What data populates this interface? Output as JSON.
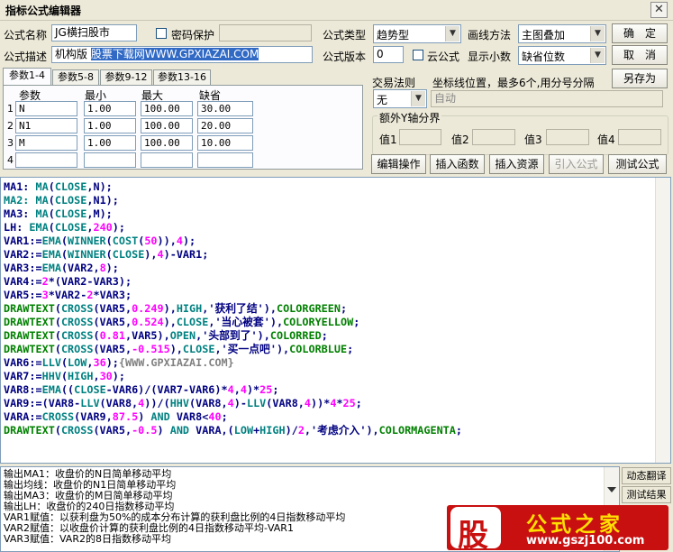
{
  "window": {
    "title": "指标公式编辑器",
    "close_glyph": "✕"
  },
  "form": {
    "name_label": "公式名称",
    "name_value": "JG横扫股市",
    "password_label": "密码保护",
    "desc_label": "公式描述",
    "desc_prefix": "机构版 ",
    "desc_highlight": "股票下载网WWW.GPXIAZAI.COM",
    "type_label": "公式类型",
    "type_value": "趋势型",
    "draw_label": "画线方法",
    "draw_value": "主图叠加",
    "version_label": "公式版本",
    "version_value": "0",
    "cloud_label": "云公式",
    "decimals_label": "显示小数",
    "decimals_value": "缺省位数"
  },
  "buttons": {
    "ok": "确　定",
    "cancel": "取　消",
    "save_as": "另存为",
    "edit_ops": "编辑操作",
    "insert_func": "插入函数",
    "insert_res": "插入资源",
    "import_formula": "引入公式",
    "test_formula": "测试公式"
  },
  "tabs": [
    "参数1-4",
    "参数5-8",
    "参数9-12",
    "参数13-16"
  ],
  "params": {
    "headers": [
      "参数",
      "最小",
      "最大",
      "缺省"
    ],
    "rows": [
      {
        "idx": "1",
        "name": "N",
        "min": "1.00",
        "max": "100.00",
        "def": "30.00"
      },
      {
        "idx": "2",
        "name": "N1",
        "min": "1.00",
        "max": "100.00",
        "def": "20.00"
      },
      {
        "idx": "3",
        "name": "M",
        "min": "1.00",
        "max": "100.00",
        "def": "10.00"
      },
      {
        "idx": "4",
        "name": "",
        "min": "",
        "max": "",
        "def": ""
      }
    ]
  },
  "trade": {
    "rule_label": "交易法则",
    "rule_value": "无",
    "coord_label": "坐标线位置，最多6个,用分号分隔",
    "coord_placeholder": "自动",
    "yaxis_label": "额外Y轴分界",
    "values": [
      "值1",
      "值2",
      "值3",
      "值4"
    ]
  },
  "code_lines": [
    [
      [
        "MA1: ",
        "#000080"
      ],
      [
        "MA",
        "#008080"
      ],
      [
        "(",
        "#000080"
      ],
      [
        "CLOSE",
        "#008080"
      ],
      [
        ",N);",
        "#000080"
      ]
    ],
    [
      [
        "MA2: ",
        "#008080"
      ],
      [
        "MA",
        "#008080"
      ],
      [
        "(",
        "#000080"
      ],
      [
        "CLOSE",
        "#008080"
      ],
      [
        ",N1);",
        "#000080"
      ]
    ],
    [
      [
        "MA3: ",
        "#000080"
      ],
      [
        "MA",
        "#008080"
      ],
      [
        "(",
        "#000080"
      ],
      [
        "CLOSE",
        "#008080"
      ],
      [
        ",M);",
        "#000080"
      ]
    ],
    [
      [
        "LH: ",
        "#000080"
      ],
      [
        "EMA",
        "#008080"
      ],
      [
        "(",
        "#000080"
      ],
      [
        "CLOSE",
        "#008080"
      ],
      [
        ",",
        "#000080"
      ],
      [
        "240",
        "#ff00ff"
      ],
      [
        ");",
        "#000080"
      ]
    ],
    [
      [
        "VAR1:=",
        "#000080"
      ],
      [
        "EMA",
        "#008080"
      ],
      [
        "(",
        "#000080"
      ],
      [
        "WINNER",
        "#008080"
      ],
      [
        "(",
        "#000080"
      ],
      [
        "COST",
        "#008080"
      ],
      [
        "(",
        "#000080"
      ],
      [
        "50",
        "#ff00ff"
      ],
      [
        ")),",
        "#000080"
      ],
      [
        "4",
        "#ff00ff"
      ],
      [
        ");",
        "#000080"
      ]
    ],
    [
      [
        "VAR2:=",
        "#000080"
      ],
      [
        "EMA",
        "#008080"
      ],
      [
        "(",
        "#000080"
      ],
      [
        "WINNER",
        "#008080"
      ],
      [
        "(",
        "#000080"
      ],
      [
        "CLOSE",
        "#008080"
      ],
      [
        "),",
        "#000080"
      ],
      [
        "4",
        "#ff00ff"
      ],
      [
        ")-VAR1;",
        "#000080"
      ]
    ],
    [
      [
        "VAR3:=",
        "#000080"
      ],
      [
        "EMA",
        "#008080"
      ],
      [
        "(VAR2,",
        "#000080"
      ],
      [
        "8",
        "#ff00ff"
      ],
      [
        ");",
        "#000080"
      ]
    ],
    [
      [
        "VAR4:=",
        "#000080"
      ],
      [
        "2",
        "#ff00ff"
      ],
      [
        "*(VAR2-VAR3);",
        "#000080"
      ]
    ],
    [
      [
        "VAR5:=",
        "#000080"
      ],
      [
        "3",
        "#ff00ff"
      ],
      [
        "*VAR2-",
        "#000080"
      ],
      [
        "2",
        "#ff00ff"
      ],
      [
        "*VAR3;",
        "#000080"
      ]
    ],
    [
      [
        "DRAWTEXT",
        "#008000"
      ],
      [
        "(",
        "#000080"
      ],
      [
        "CROSS",
        "#008080"
      ],
      [
        "(VAR5,",
        "#000080"
      ],
      [
        "0.249",
        "#ff00ff"
      ],
      [
        "),",
        "#000080"
      ],
      [
        "HIGH",
        "#008080"
      ],
      [
        ",",
        "#000080"
      ],
      [
        "'获利了结'",
        "#000080"
      ],
      [
        "),",
        "#000080"
      ],
      [
        "COLORGREEN",
        "#008000"
      ],
      [
        ";",
        "#000080"
      ]
    ],
    [
      [
        "DRAWTEXT",
        "#008000"
      ],
      [
        "(",
        "#000080"
      ],
      [
        "CROSS",
        "#008080"
      ],
      [
        "(VAR5,",
        "#000080"
      ],
      [
        "0.524",
        "#ff00ff"
      ],
      [
        "),",
        "#000080"
      ],
      [
        "CLOSE",
        "#008080"
      ],
      [
        ",",
        "#000080"
      ],
      [
        "'当心被套'",
        "#000080"
      ],
      [
        "),",
        "#000080"
      ],
      [
        "COLORYELLOW",
        "#008000"
      ],
      [
        ";",
        "#000080"
      ]
    ],
    [
      [
        "DRAWTEXT",
        "#008000"
      ],
      [
        "(",
        "#000080"
      ],
      [
        "CROSS",
        "#008080"
      ],
      [
        "(",
        "#000080"
      ],
      [
        "0.81",
        "#ff00ff"
      ],
      [
        ",VAR5),",
        "#000080"
      ],
      [
        "OPEN",
        "#008080"
      ],
      [
        ",",
        "#000080"
      ],
      [
        "'头部到了'",
        "#000080"
      ],
      [
        "),",
        "#000080"
      ],
      [
        "COLORRED",
        "#008000"
      ],
      [
        ";",
        "#000080"
      ]
    ],
    [
      [
        "DRAWTEXT",
        "#008000"
      ],
      [
        "(",
        "#000080"
      ],
      [
        "CROSS",
        "#008080"
      ],
      [
        "(VAR5,",
        "#000080"
      ],
      [
        "-0.515",
        "#ff00ff"
      ],
      [
        "),",
        "#000080"
      ],
      [
        "CLOSE",
        "#008080"
      ],
      [
        ",",
        "#000080"
      ],
      [
        "'买一点吧'",
        "#000080"
      ],
      [
        "),",
        "#000080"
      ],
      [
        "COLORBLUE",
        "#008000"
      ],
      [
        ";",
        "#000080"
      ]
    ],
    [
      [
        "VAR6:=",
        "#000080"
      ],
      [
        "LLV",
        "#008080"
      ],
      [
        "(",
        "#000080"
      ],
      [
        "LOW",
        "#008080"
      ],
      [
        ",",
        "#000080"
      ],
      [
        "36",
        "#ff00ff"
      ],
      [
        ");",
        "#000080"
      ],
      [
        "{WWW.GPXIAZAI.COM}",
        "#808080"
      ]
    ],
    [
      [
        "VAR7:=",
        "#000080"
      ],
      [
        "HHV",
        "#008080"
      ],
      [
        "(",
        "#000080"
      ],
      [
        "HIGH",
        "#008080"
      ],
      [
        ",",
        "#000080"
      ],
      [
        "30",
        "#ff00ff"
      ],
      [
        ");",
        "#000080"
      ]
    ],
    [
      [
        "VAR8:=",
        "#000080"
      ],
      [
        "EMA",
        "#008080"
      ],
      [
        "((",
        "#000080"
      ],
      [
        "CLOSE",
        "#008080"
      ],
      [
        "-VAR6)/(VAR7-VAR6)*",
        "#000080"
      ],
      [
        "4",
        "#ff00ff"
      ],
      [
        ",",
        "#000080"
      ],
      [
        "4",
        "#ff00ff"
      ],
      [
        ")*",
        "#000080"
      ],
      [
        "25",
        "#ff00ff"
      ],
      [
        ";",
        "#000080"
      ]
    ],
    [
      [
        "VAR9:=(VAR8-",
        "#000080"
      ],
      [
        "LLV",
        "#008080"
      ],
      [
        "(VAR8,",
        "#000080"
      ],
      [
        "4",
        "#ff00ff"
      ],
      [
        "))/(",
        "#000080"
      ],
      [
        "HHV",
        "#008080"
      ],
      [
        "(VAR8,",
        "#000080"
      ],
      [
        "4",
        "#ff00ff"
      ],
      [
        ")-",
        "#000080"
      ],
      [
        "LLV",
        "#008080"
      ],
      [
        "(VAR8,",
        "#000080"
      ],
      [
        "4",
        "#ff00ff"
      ],
      [
        "))*",
        "#000080"
      ],
      [
        "4",
        "#ff00ff"
      ],
      [
        "*",
        "#000080"
      ],
      [
        "25",
        "#ff00ff"
      ],
      [
        ";",
        "#000080"
      ]
    ],
    [
      [
        "VARA:=",
        "#000080"
      ],
      [
        "CROSS",
        "#008080"
      ],
      [
        "(VAR9,",
        "#000080"
      ],
      [
        "87.5",
        "#ff00ff"
      ],
      [
        ") ",
        "#000080"
      ],
      [
        "AND",
        "#008080"
      ],
      [
        " VAR8<",
        "#000080"
      ],
      [
        "40",
        "#ff00ff"
      ],
      [
        ";",
        "#000080"
      ]
    ],
    [
      [
        "DRAWTEXT",
        "#008000"
      ],
      [
        "(",
        "#000080"
      ],
      [
        "CROSS",
        "#008080"
      ],
      [
        "(VAR5,",
        "#000080"
      ],
      [
        "-0.5",
        "#ff00ff"
      ],
      [
        ") ",
        "#000080"
      ],
      [
        "AND",
        "#008080"
      ],
      [
        " VARA,(",
        "#000080"
      ],
      [
        "LOW",
        "#008080"
      ],
      [
        "+",
        "#000080"
      ],
      [
        "HIGH",
        "#008080"
      ],
      [
        ")/",
        "#000080"
      ],
      [
        "2",
        "#ff00ff"
      ],
      [
        ",",
        "#000080"
      ],
      [
        "'考虑介入'",
        "#000080"
      ],
      [
        "),",
        "#000080"
      ],
      [
        "COLORMAGENTA",
        "#008000"
      ],
      [
        ";",
        "#000080"
      ]
    ]
  ],
  "output_lines": [
    "输出MA1：收盘价的N日简单移动平均",
    "输出均线：收盘价的N1日简单移动平均",
    "输出MA3：收盘价的M日简单移动平均",
    "输出LH：收盘价的240日指数移动平均",
    "VAR1赋值：以获利盘为50%的成本分布计算的获利盘比例的4日指数移动平均",
    "VAR2赋值：以收盘价计算的获利盘比例的4日指数移动平均-VAR1",
    "VAR3赋值：VAR2的8日指数移动平均"
  ],
  "side": {
    "dynamic_translate": "动态翻译",
    "test_result": "测试结果"
  },
  "watermark": {
    "glyph": "股",
    "brand": "公式之家",
    "url": "www.gszj100.com"
  }
}
